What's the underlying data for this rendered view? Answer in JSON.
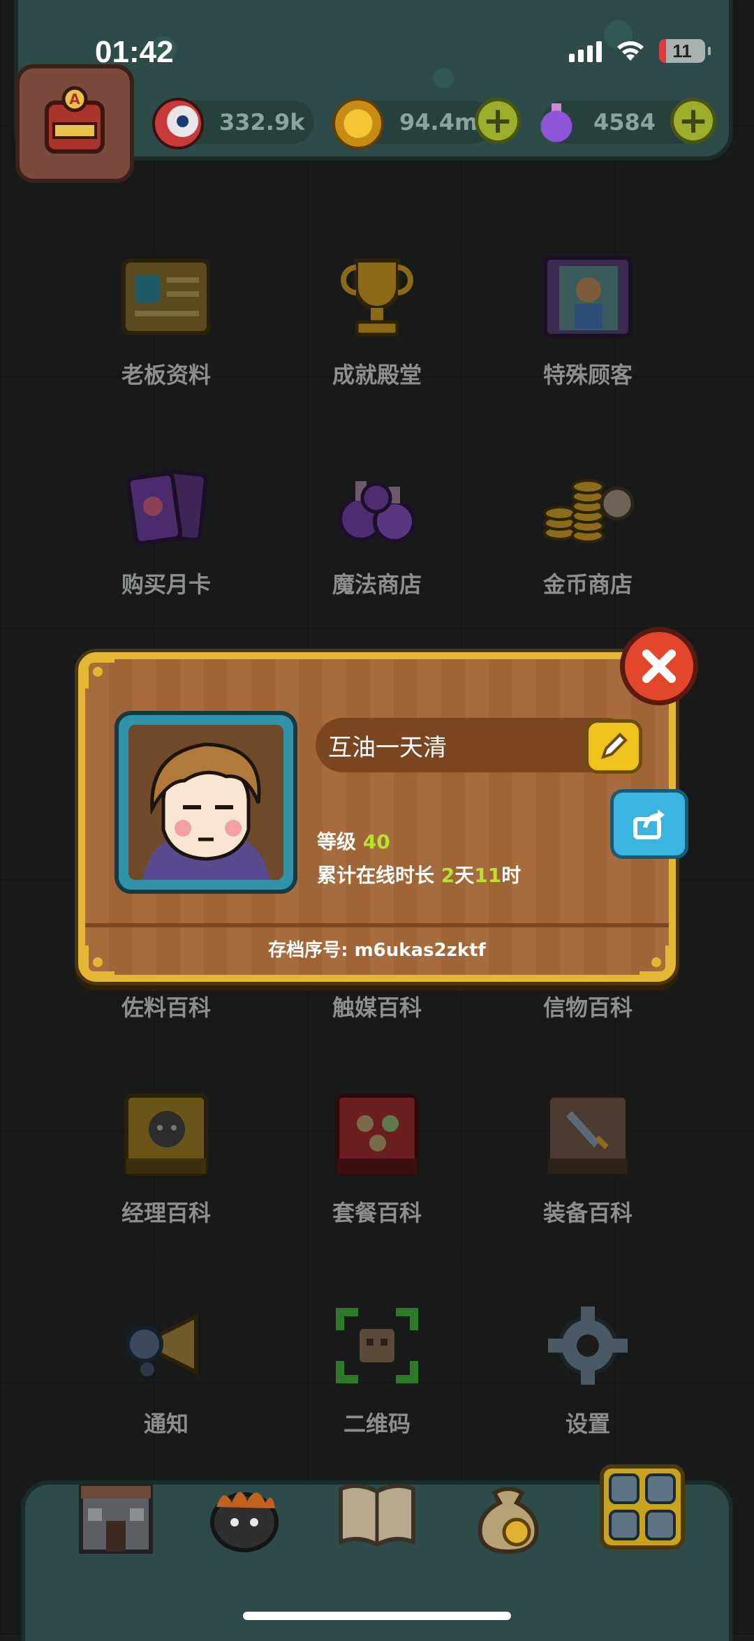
{
  "status": {
    "time": "01:42",
    "battery": "11"
  },
  "resources": {
    "eyes": "332.9k",
    "coins": "94.4m",
    "potions": "4584"
  },
  "menu": {
    "row1": [
      "老板资料",
      "成就殿堂",
      "特殊顾客"
    ],
    "row2": [
      "购买月卡",
      "魔法商店",
      "金币商店"
    ],
    "row3": [
      "佐料百科",
      "触媒百科",
      "信物百科"
    ],
    "row4": [
      "经理百科",
      "套餐百科",
      "装备百科"
    ],
    "row5": [
      "通知",
      "二维码",
      "设置"
    ]
  },
  "profile": {
    "name": "互油一天清",
    "level_label": "等级",
    "level": "40",
    "online_label": "累计在线时长",
    "online_days": "2",
    "days_unit": "天",
    "online_hours": "11",
    "hours_unit": "时",
    "serial": "存档序号: m6ukas2zktf"
  },
  "colors": {
    "accent_green": "#b7e32c",
    "modal_border": "#e3b733",
    "close_red": "#e2462b"
  }
}
